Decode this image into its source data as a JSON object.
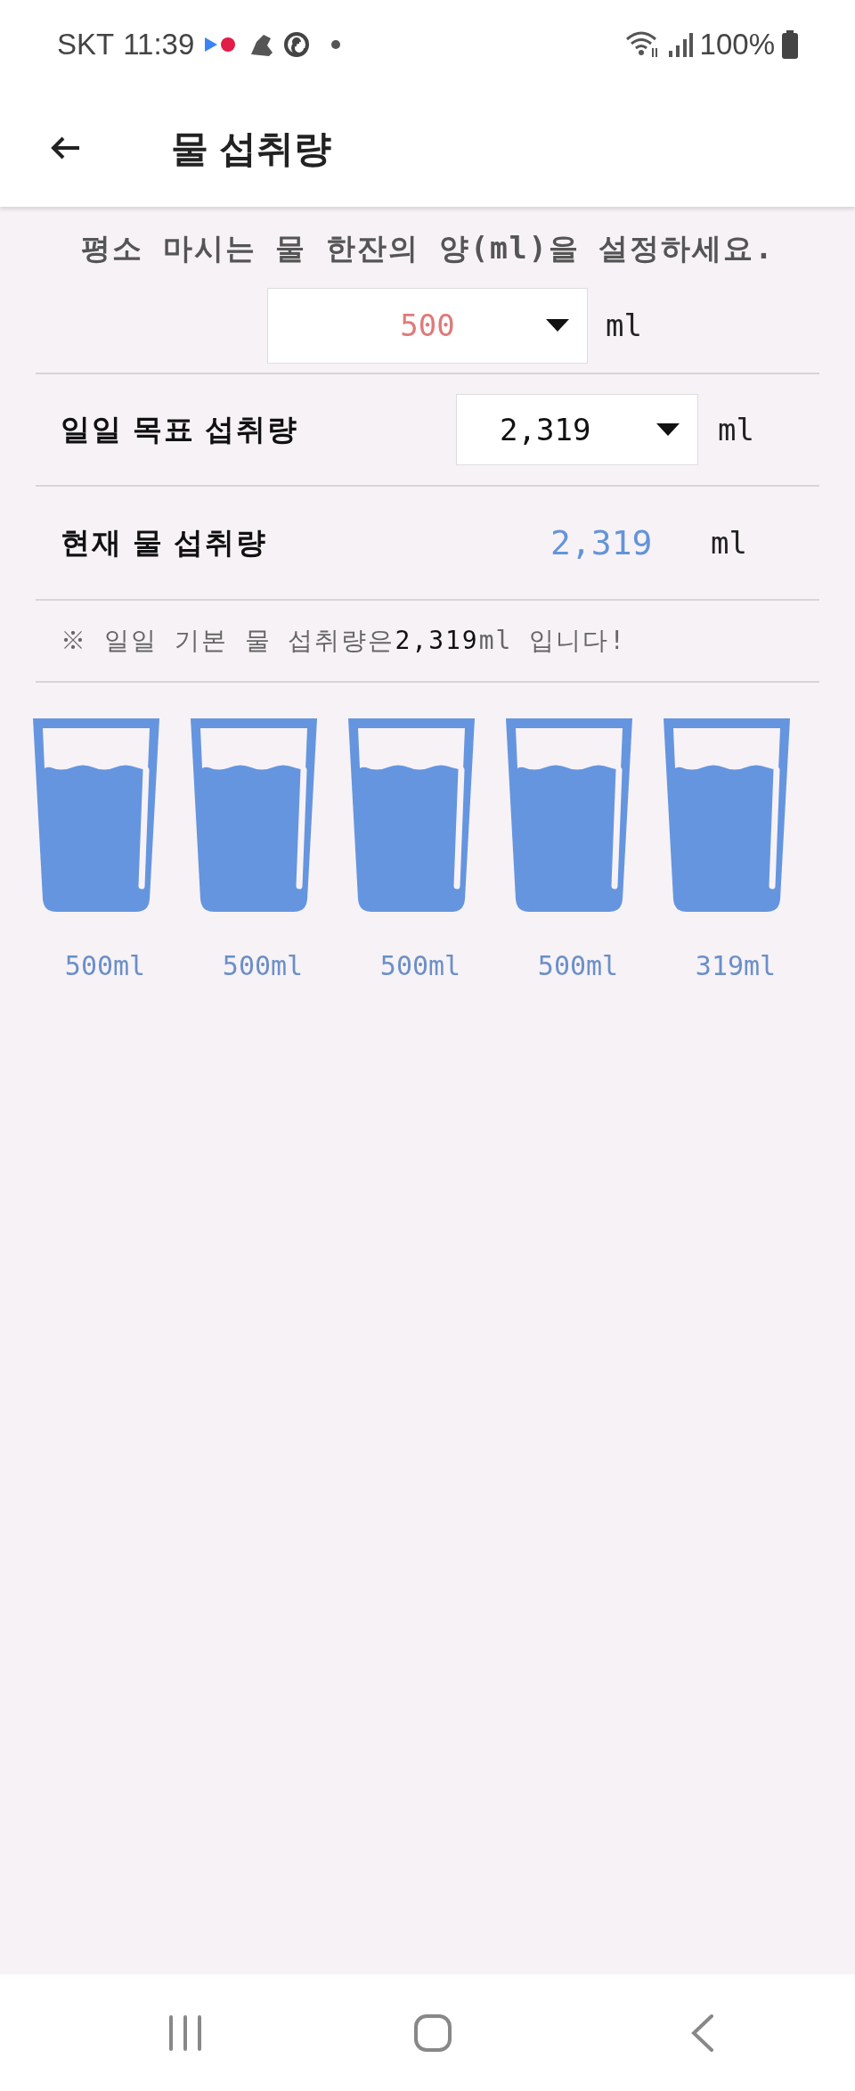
{
  "status_bar": {
    "carrier": "SKT",
    "time": "11:39",
    "battery": "100%"
  },
  "header": {
    "title": "물 섭취량"
  },
  "instruction": "평소 마시는 물 한잔의 양(ml)을 설정하세요.",
  "cup_size": {
    "value": "500",
    "unit": "ml"
  },
  "goal": {
    "label": "일일 목표 섭취량",
    "value": "2,319",
    "unit": "ml"
  },
  "current": {
    "label": "현재 물 섭취량",
    "value": "2,319",
    "unit": "ml"
  },
  "note": {
    "prefix": "※ 일일 기본 물 섭취량은",
    "amount": "2,319",
    "suffix": "ml 입니다!"
  },
  "glasses": [
    {
      "label": "500ml"
    },
    {
      "label": "500ml"
    },
    {
      "label": "500ml"
    },
    {
      "label": "500ml"
    },
    {
      "label": "319ml"
    }
  ]
}
